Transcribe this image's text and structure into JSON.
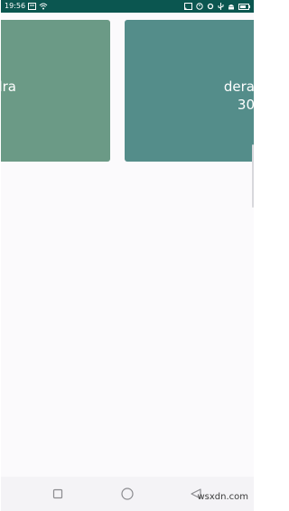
{
  "status_bar": {
    "time": "19:56"
  },
  "cards": [
    {
      "line1": "dra",
      "line2": ""
    },
    {
      "line1": "dera",
      "line2": "30"
    }
  ],
  "watermark": "wsxdn.com"
}
